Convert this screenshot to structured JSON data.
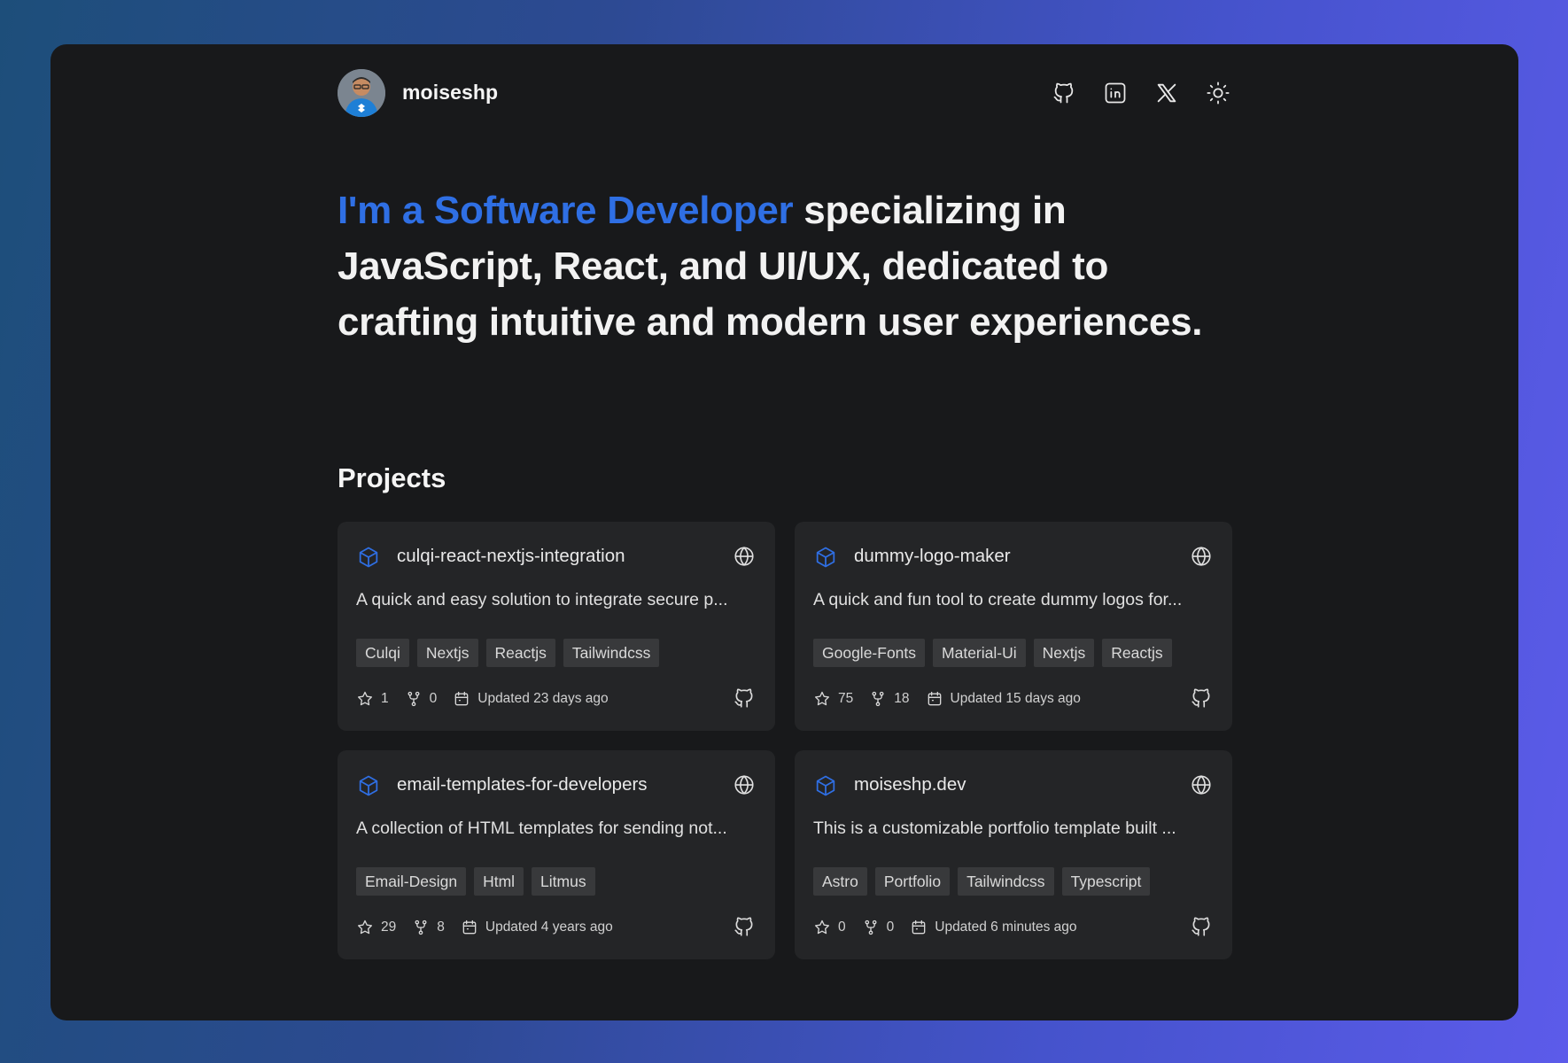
{
  "header": {
    "username": "moiseshp",
    "social_icons": [
      "github-icon",
      "linkedin-icon",
      "x-icon",
      "sun-icon"
    ]
  },
  "hero": {
    "accent": "I'm a Software Developer",
    "rest": " specializing in JavaScript, React, and UI/UX, dedicated to crafting intuitive and modern user experiences."
  },
  "projects": {
    "title": "Projects",
    "items": [
      {
        "name": "culqi-react-nextjs-integration",
        "description": "A quick and easy solution to integrate secure p...",
        "tags": [
          "Culqi",
          "Nextjs",
          "Reactjs",
          "Tailwindcss"
        ],
        "stars": "1",
        "forks": "0",
        "updated": "Updated 23 days ago"
      },
      {
        "name": "dummy-logo-maker",
        "description": "A quick and fun tool to create dummy logos for...",
        "tags": [
          "Google-Fonts",
          "Material-Ui",
          "Nextjs",
          "Reactjs"
        ],
        "stars": "75",
        "forks": "18",
        "updated": "Updated 15 days ago"
      },
      {
        "name": "email-templates-for-developers",
        "description": "A collection of HTML templates for sending not...",
        "tags": [
          "Email-Design",
          "Html",
          "Litmus"
        ],
        "stars": "29",
        "forks": "8",
        "updated": "Updated 4 years ago"
      },
      {
        "name": "moiseshp.dev",
        "description": "This is a customizable portfolio template built ...",
        "tags": [
          "Astro",
          "Portfolio",
          "Tailwindcss",
          "Typescript"
        ],
        "stars": "0",
        "forks": "0",
        "updated": "Updated 6 minutes ago"
      }
    ]
  },
  "colors": {
    "accent": "#2f6fe4",
    "frame_bg": "#18191b",
    "card_bg": "#242527",
    "tag_bg": "#38393b"
  }
}
